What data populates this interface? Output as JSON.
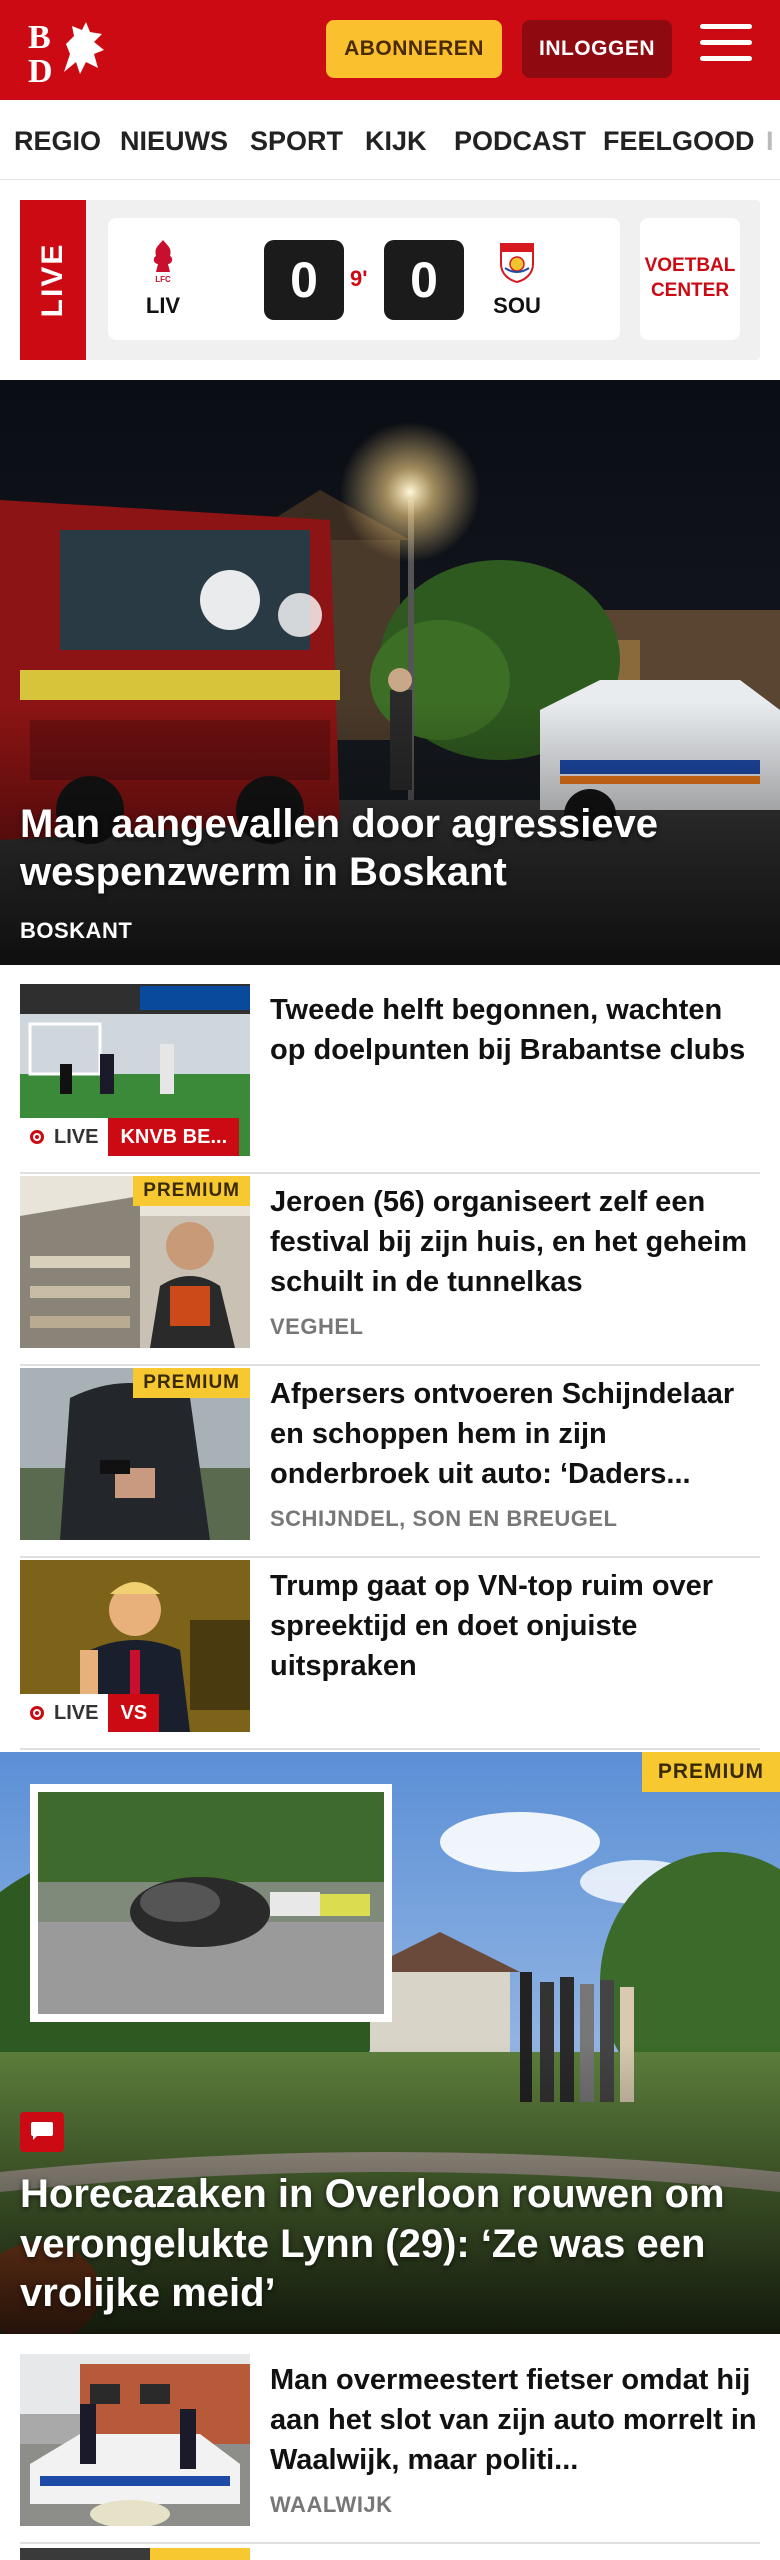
{
  "header": {
    "subscribe_label": "ABONNEREN",
    "login_label": "INLOGGEN",
    "brand_color": "#cc0a13"
  },
  "nav": {
    "items": [
      "REGIO",
      "NIEUWS",
      "SPORT",
      "KIJK",
      "PODCAST",
      "FEELGOOD"
    ]
  },
  "live_widget": {
    "tab_label": "LIVE",
    "home_team": "LIV",
    "away_team": "SOU",
    "home_score": "0",
    "away_score": "0",
    "minute": "9'",
    "center_label_1": "VOETBAL",
    "center_label_2": "CENTER"
  },
  "hero": {
    "title": "Man aangevallen door agressieve wespenzwerm in Boskant",
    "location": "BOSKANT"
  },
  "articles": [
    {
      "title": "Tweede helft begonnen, wachten op doelpunten bij Brabantse clubs",
      "live_label": "LIVE",
      "tag": "KNVB BE..."
    },
    {
      "title": "Jeroen (56) organiseert zelf een festival bij zijn huis, en het geheim schuilt in de tunnelkas",
      "location": "VEGHEL",
      "badge": "PREMIUM"
    },
    {
      "title": "Afpersers ontvoeren Schijnde­laar en schoppen hem in zijn onderbroek uit auto: ‘Daders...",
      "location": "SCHIJNDEL, SON EN BREUGEL",
      "badge": "PREMIUM"
    },
    {
      "title": "Trump gaat op VN-top ruim over spreektijd en doet onjuiste uitspraken",
      "live_label": "LIVE",
      "tag": "VS"
    }
  ],
  "big_card": {
    "badge": "PREMIUM",
    "title": "Horecazaken in Overloon rouwen om verongelukte Lynn (29): ‘Ze was een vrolijke meid’"
  },
  "last_article": {
    "title": "Man overmeestert fietser omdat hij aan het slot van zijn auto morrelt in Waalwijk, maar politi...",
    "location": "WAALWIJK"
  }
}
